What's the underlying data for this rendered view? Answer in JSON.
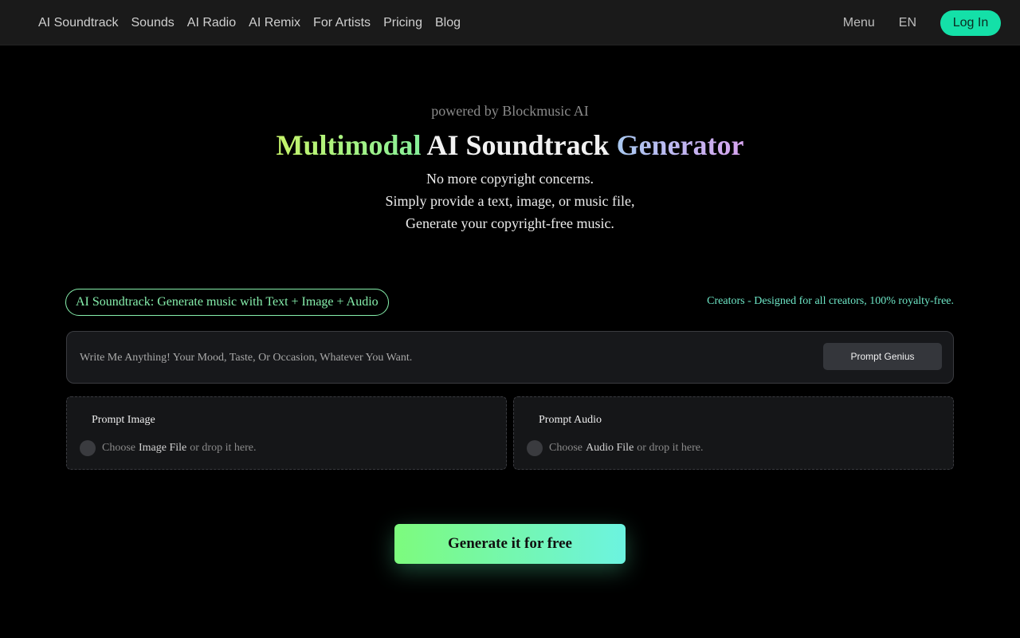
{
  "nav": {
    "links": [
      "AI Soundtrack",
      "Sounds",
      "AI Radio",
      "AI Remix",
      "For Artists",
      "Pricing",
      "Blog"
    ],
    "menu_label": "Menu",
    "lang_label": "EN",
    "login_label": "Log In"
  },
  "hero": {
    "powered_by": "powered by Blockmusic AI",
    "headline_part1": "Multimodal",
    "headline_part2": " AI Soundtrack ",
    "headline_part3": "Generator",
    "sub_line1": "No more copyright concerns.",
    "sub_line2": "Simply provide a text, image, or music file,",
    "sub_line3": "Generate your copyright-free music."
  },
  "generator": {
    "mode_label": "AI Soundtrack: Generate music with Text + Image + Audio",
    "creators_note": "Creators - Designed for all creators, 100% royalty-free.",
    "prompt_placeholder": "Write Me Anything! Your Mood, Taste, Or Occasion, Whatever You Want.",
    "prompt_value": "",
    "prompt_genius_label": "Prompt Genius",
    "image_upload": {
      "title": "Prompt Image",
      "choose": "Choose",
      "file_label": "Image File",
      "drop_hint": "or drop it here."
    },
    "audio_upload": {
      "title": "Prompt Audio",
      "choose": "Choose",
      "file_label": "Audio File",
      "drop_hint": "or drop it here."
    },
    "generate_label": "Generate it for free"
  },
  "colors": {
    "accent": "#14e0a8",
    "pill_border": "#86efac",
    "background": "#000000"
  }
}
